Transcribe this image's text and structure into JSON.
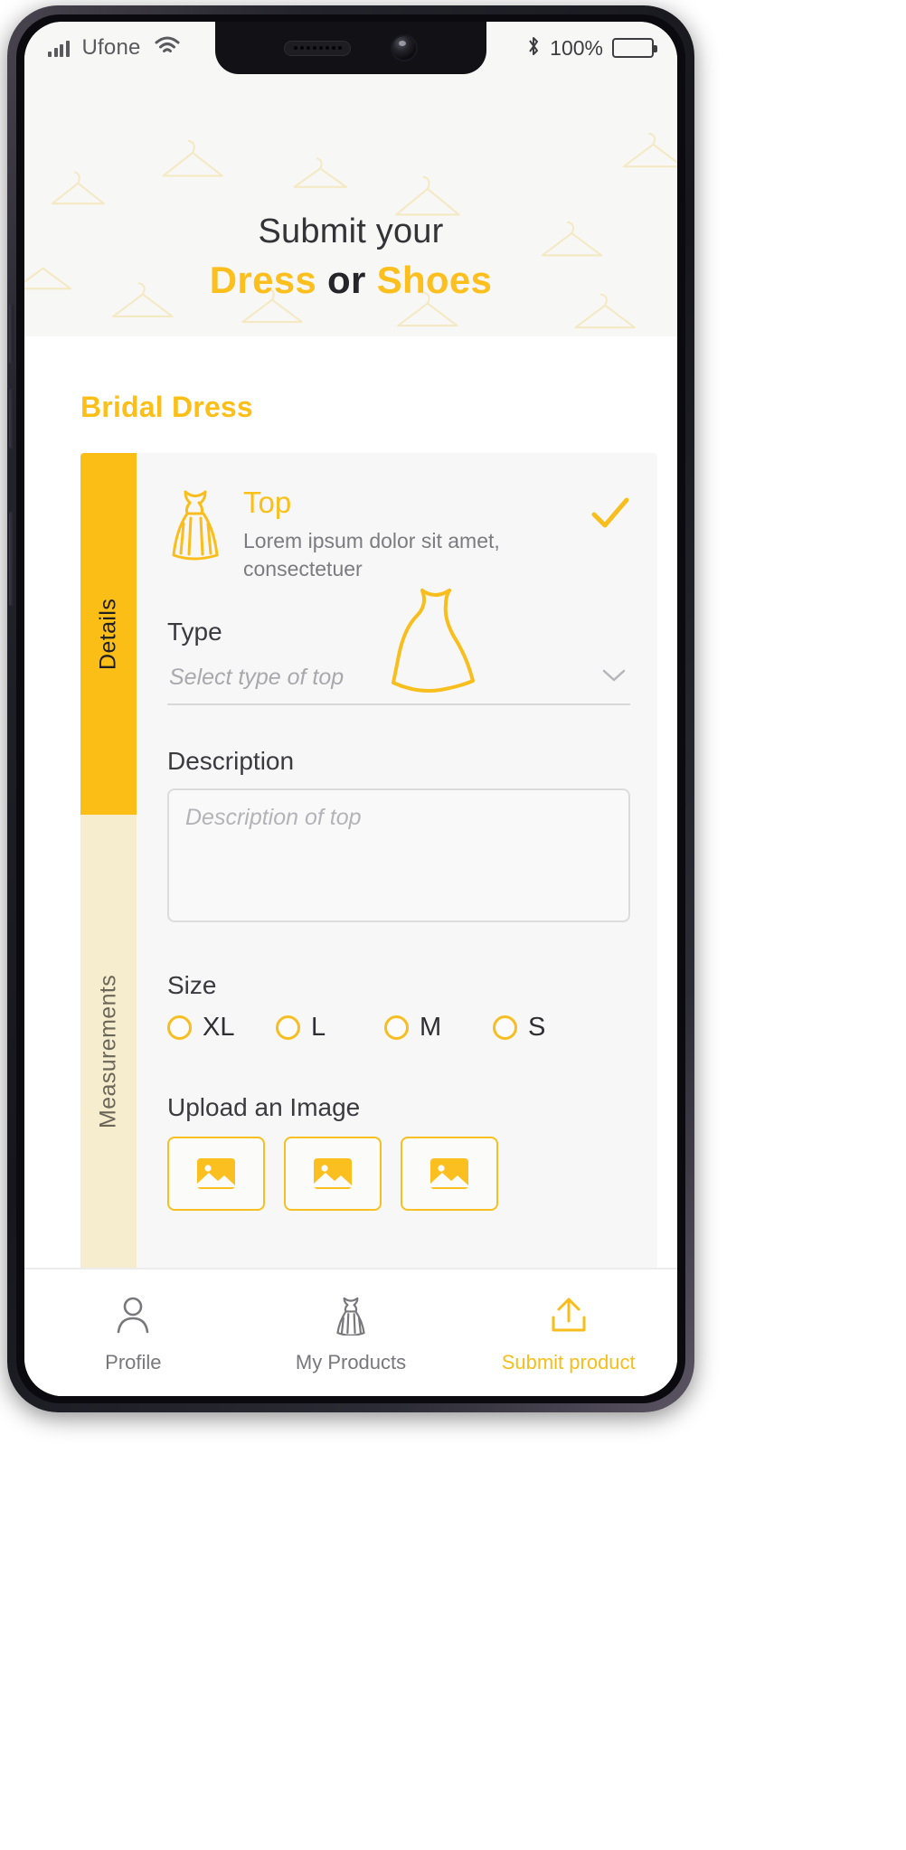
{
  "status_bar": {
    "carrier": "Ufone",
    "wifi_icon": "wifi-icon",
    "signal_icon": "signal-bars-icon",
    "bluetooth_icon": "bluetooth-icon",
    "battery_percent": "100%",
    "battery_icon": "battery-full-icon"
  },
  "header": {
    "line1": "Submit your",
    "line2_part1": "Dress",
    "line2_part2": "or",
    "line2_part3": "Shoes",
    "background_pattern": "clothes-hanger-pattern",
    "accent_color": "#FCBF1E",
    "dark_color": "#25252a",
    "background_color": "#f7f7f5"
  },
  "page": {
    "section_title": "Bridal Dress"
  },
  "tabs": [
    {
      "label": "Details",
      "active": true
    },
    {
      "label": "Measurements",
      "active": false
    }
  ],
  "card": {
    "icon": "dress-icon",
    "title": "Top",
    "subtitle": "Lorem ipsum dolor sit amet, consectetuer",
    "completed_icon": "check-icon",
    "watermark_icon": "dress-outline-watermark"
  },
  "form": {
    "type": {
      "label": "Type",
      "placeholder": "Select type of top",
      "value": "",
      "chevron_icon": "chevron-down-icon"
    },
    "description": {
      "label": "Description",
      "placeholder": "Description of top",
      "value": ""
    },
    "size": {
      "label": "Size",
      "options": [
        {
          "label": "XL",
          "selected": false
        },
        {
          "label": "L",
          "selected": false
        },
        {
          "label": "M",
          "selected": false
        },
        {
          "label": "S",
          "selected": false
        }
      ]
    },
    "upload": {
      "label": "Upload an Image",
      "slots": [
        {
          "icon": "image-placeholder-icon"
        },
        {
          "icon": "image-placeholder-icon"
        },
        {
          "icon": "image-placeholder-icon"
        }
      ]
    }
  },
  "bottom_nav": [
    {
      "label": "Profile",
      "icon": "person-icon",
      "active": false
    },
    {
      "label": "My Products",
      "icon": "dress-icon",
      "active": false
    },
    {
      "label": "Submit product",
      "icon": "upload-icon",
      "active": true
    }
  ],
  "colors": {
    "amber": "#FBBF18",
    "amber_tab": "#FBBE17",
    "cream_tab": "#F6EDCE",
    "card_bg": "#f7f7f7",
    "text_dark": "#3a3a3f",
    "text_muted": "#7b7b80"
  }
}
